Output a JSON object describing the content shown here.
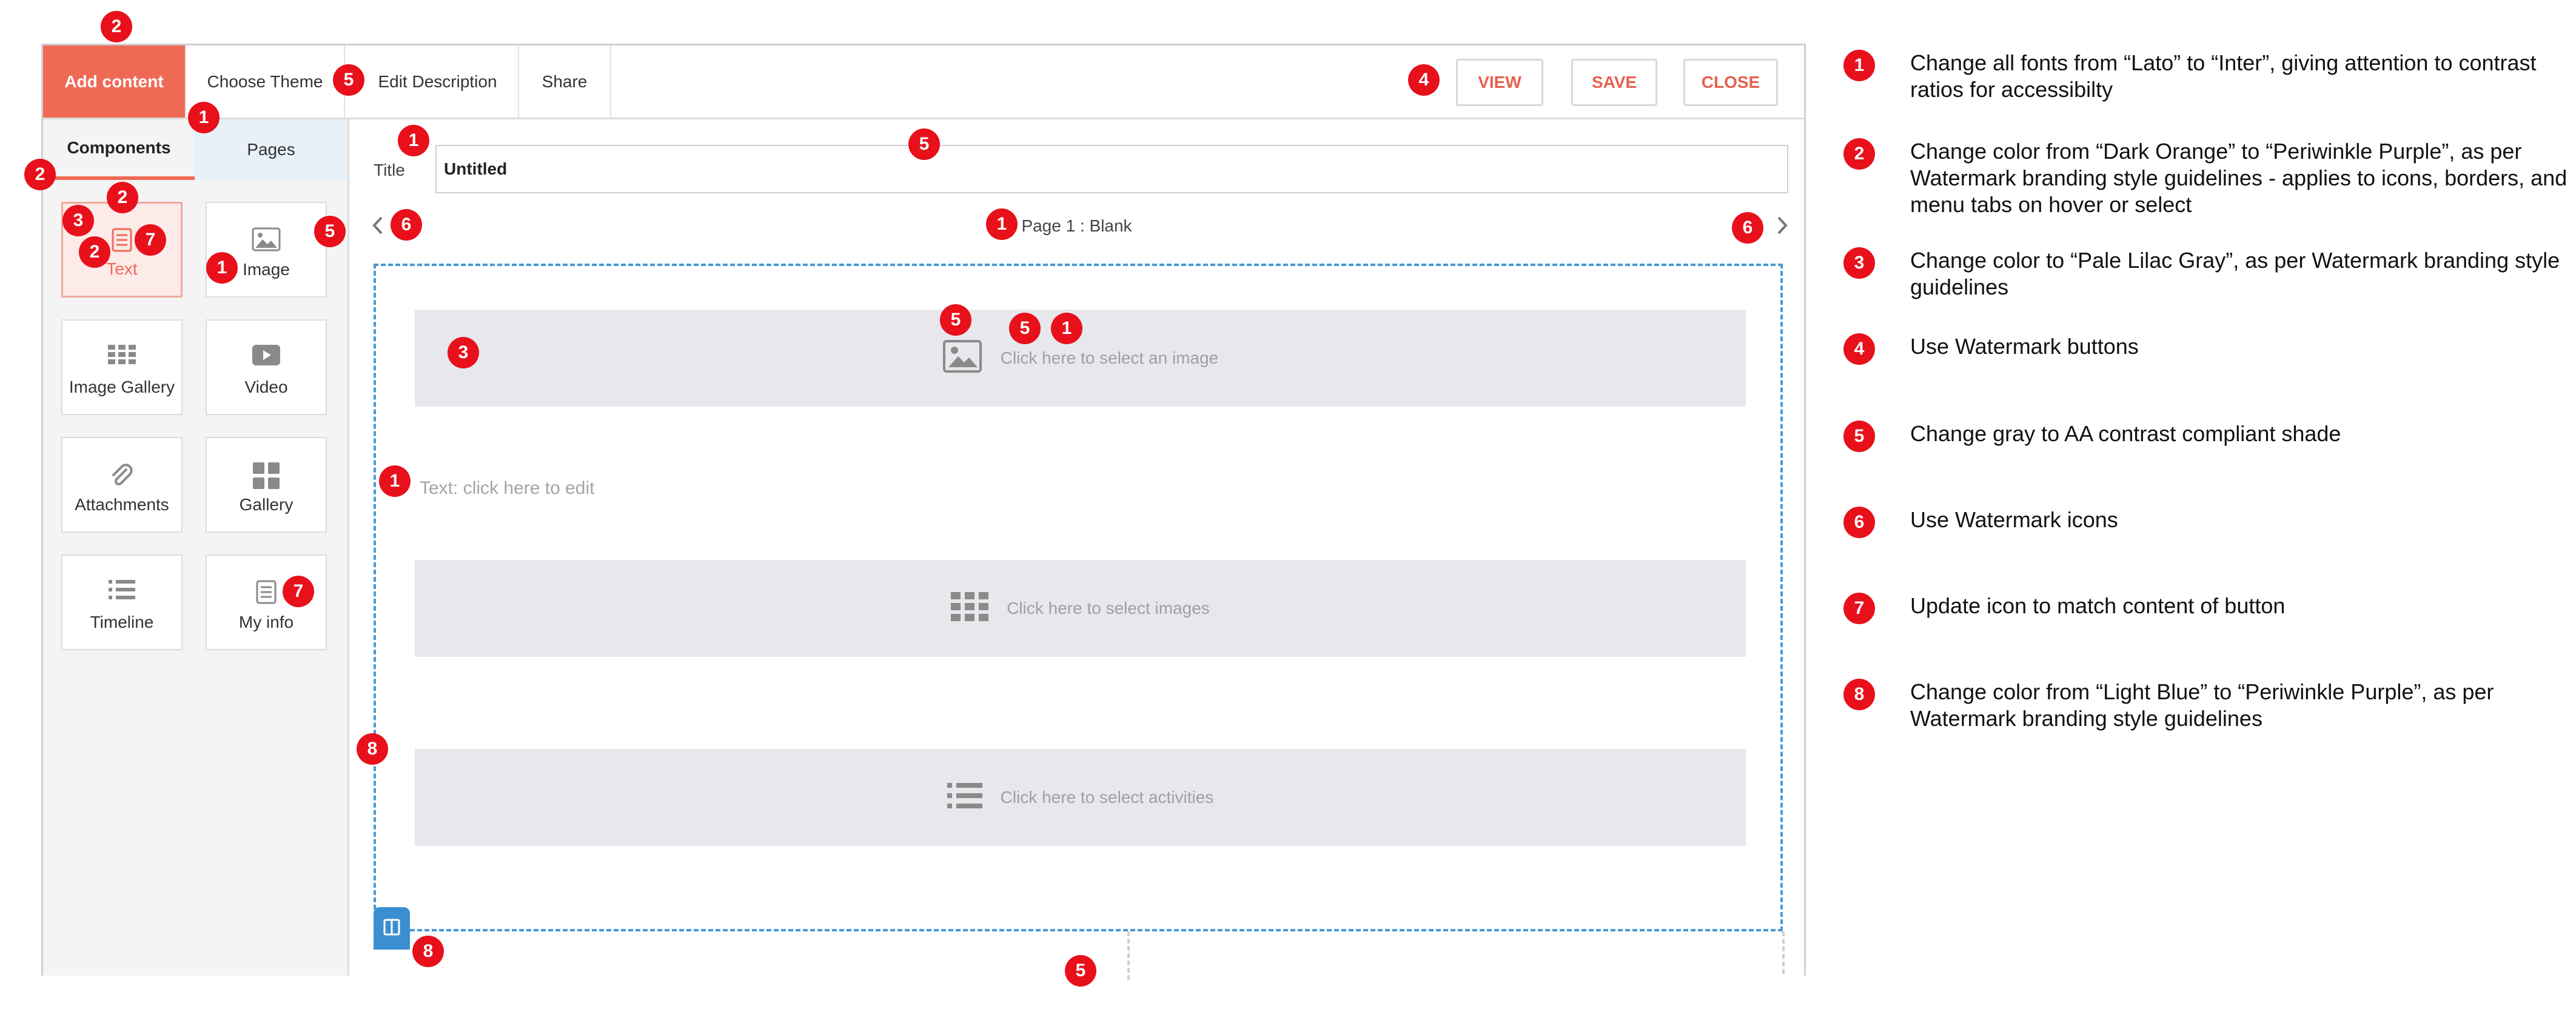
{
  "topbar": {
    "tabs": [
      "Add content",
      "Choose Theme",
      "Edit Description",
      "Share"
    ],
    "buttons": {
      "view": "VIEW",
      "save": "SAVE",
      "close": "CLOSE"
    }
  },
  "sidebar": {
    "tabs": [
      "Components",
      "Pages"
    ],
    "components": [
      {
        "label": "Text",
        "icon": "document-icon"
      },
      {
        "label": "Image",
        "icon": "image-icon"
      },
      {
        "label": "Image Gallery",
        "icon": "grid-icon"
      },
      {
        "label": "Video",
        "icon": "play-icon"
      },
      {
        "label": "Attachments",
        "icon": "paperclip-icon"
      },
      {
        "label": "Gallery",
        "icon": "tiles-icon"
      },
      {
        "label": "Timeline",
        "icon": "list-icon"
      },
      {
        "label": "My info",
        "icon": "document-icon"
      }
    ]
  },
  "main": {
    "title_label": "Title",
    "title_value": "Untitled",
    "page_label": "Page 1 : Blank",
    "placeholders": {
      "image": "Click here to select an image",
      "text": "Text: click here to edit",
      "images": "Click here to select images",
      "activities": "Click here to select activities"
    }
  },
  "markers": [
    "1",
    "2",
    "3",
    "4",
    "5",
    "6",
    "7",
    "8"
  ],
  "legend": [
    {
      "n": "1",
      "text": "Change all fonts from “Lato” to “Inter”, giving attention to contrast ratios for accessibilty"
    },
    {
      "n": "2",
      "text": "Change color from “Dark Orange” to “Periwinkle Purple”, as per Watermark branding style guidelines - applies to icons, borders, and menu tabs on hover or select"
    },
    {
      "n": "3",
      "text": "Change color to “Pale Lilac Gray”, as per Watermark branding style guidelines"
    },
    {
      "n": "4",
      "text": "Use Watermark buttons"
    },
    {
      "n": "5",
      "text": "Change gray to AA contrast compliant shade"
    },
    {
      "n": "6",
      "text": "Use Watermark icons"
    },
    {
      "n": "7",
      "text": "Update icon to match content of button"
    },
    {
      "n": "8",
      "text": "Change color from “Light Blue” to “Periwinkle Purple”, as per Watermark branding style guidelines"
    }
  ],
  "colors": {
    "accent": "#ef6a55",
    "marker": "#e8101b",
    "canvas_border": "#4a9ad4",
    "placeholder_bg": "#e7e7ec"
  }
}
